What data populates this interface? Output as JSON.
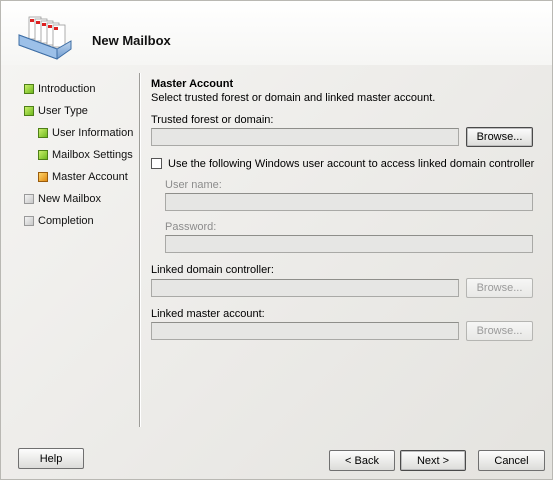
{
  "window": {
    "title": "New Mailbox"
  },
  "sidebar": {
    "items": [
      {
        "label": "Introduction",
        "state": "complete",
        "color": "#6fb81f"
      },
      {
        "label": "User Type",
        "state": "complete",
        "color": "#6fb81f"
      },
      {
        "label": "User Information",
        "state": "complete",
        "color": "#6fb81f"
      },
      {
        "label": "Mailbox Settings",
        "state": "complete",
        "color": "#6fb81f"
      },
      {
        "label": "Master Account",
        "state": "current",
        "color": "#e08a12"
      },
      {
        "label": "New Mailbox",
        "state": "pending",
        "color": "#c8c8c8"
      },
      {
        "label": "Completion",
        "state": "pending",
        "color": "#c8c8c8"
      }
    ]
  },
  "main": {
    "section_title": "Master Account",
    "section_subtitle": "Select trusted forest or domain and linked master account.",
    "trusted_forest": {
      "label": "Trusted forest or domain:",
      "value": "",
      "browse_label": "Browse..."
    },
    "use_windows_account": {
      "label": "Use the following Windows user account to access linked domain controller",
      "checked": false
    },
    "user_name": {
      "label": "User name:",
      "value": ""
    },
    "password": {
      "label": "Password:",
      "value": ""
    },
    "linked_dc": {
      "label": "Linked domain controller:",
      "value": "",
      "browse_label": "Browse..."
    },
    "linked_master": {
      "label": "Linked master account:",
      "value": "",
      "browse_label": "Browse..."
    }
  },
  "footer": {
    "help_label": "Help",
    "back_label": "< Back",
    "next_label": "Next >",
    "cancel_label": "Cancel"
  }
}
